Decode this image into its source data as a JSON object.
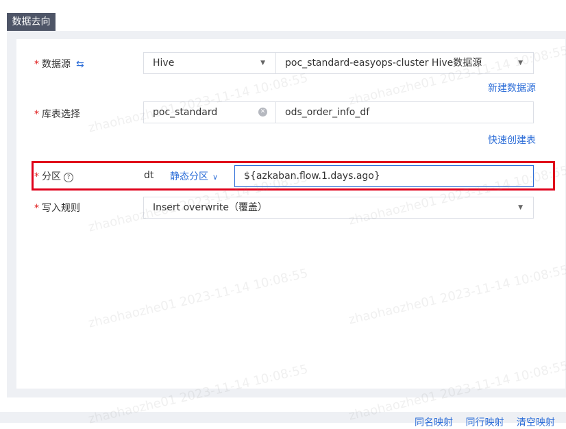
{
  "section": {
    "title": "数据去向"
  },
  "form": {
    "datasource": {
      "label": "数据源",
      "swap_icon": "swap-arrows-icon",
      "type_value": "Hive",
      "source_value": "poc_standard-easyops-cluster Hive数据源",
      "new_link": "新建数据源"
    },
    "table": {
      "label": "库表选择",
      "db_value": "poc_standard",
      "table_value": "ods_order_info_df",
      "create_link": "快速创建表"
    },
    "partition": {
      "label": "分区",
      "help_icon": "question-circle-icon",
      "field": "dt",
      "mode": "静态分区",
      "value": "${azkaban.flow.1.days.ago}"
    },
    "write_rule": {
      "label": "写入规则",
      "value": "Insert overwrite（覆盖）"
    }
  },
  "footer": {
    "links": [
      "同名映射",
      "同行映射",
      "清空映射"
    ]
  },
  "watermark": {
    "text": "zhaohaozhe01 2023-11-14 10:08:55"
  },
  "colors": {
    "accent": "#2f6fd8",
    "required": "#e02020",
    "highlight": "#e0001a",
    "tab_bg": "#4e5567"
  }
}
